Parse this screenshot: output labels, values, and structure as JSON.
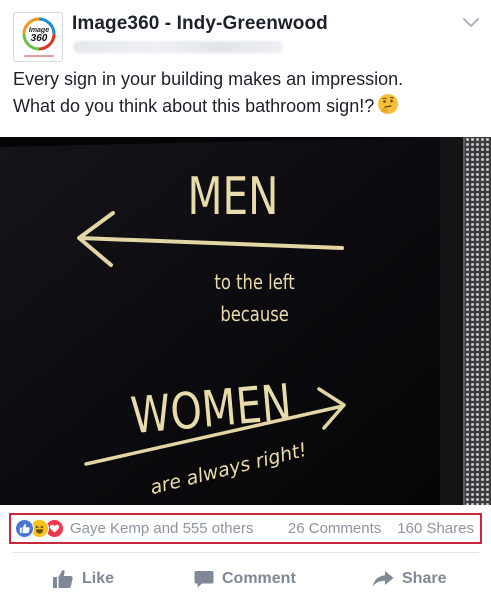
{
  "post": {
    "page_name": "Image360 - Indy-Greenwood",
    "avatar_text": "Image 360",
    "text_line1": "Every sign in your building makes an impression.",
    "text_line2": "What do you think about this bathroom sign!?",
    "emoji": "thinking-face-icon"
  },
  "photo": {
    "sign_line1": "MEN",
    "sign_line2": "to the left",
    "sign_line3": "because",
    "sign_line4": "WOMEN",
    "sign_line5": "are always right!"
  },
  "reactions": {
    "icons": [
      "like-reaction-icon",
      "haha-reaction-icon",
      "love-reaction-icon"
    ],
    "reactors": "Gaye Kemp and 555 others",
    "comments": "26 Comments",
    "shares": "160 Shares",
    "highlight_color": "#c7293b"
  },
  "actions": {
    "like": "Like",
    "comment": "Comment",
    "share": "Share"
  },
  "colors": {
    "text": "#1d2129",
    "meta": "#8d949e",
    "action": "#7f8894",
    "like_blue": "#4a76d1",
    "love_red": "#f0384c",
    "haha_yellow": "#f7c21a"
  }
}
